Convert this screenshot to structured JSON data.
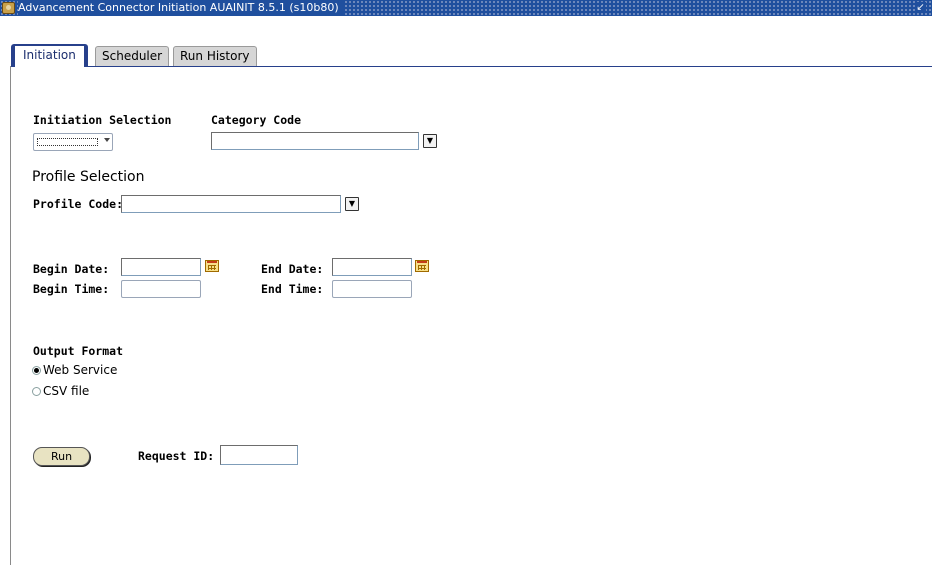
{
  "window": {
    "title": "Advancement Connector Initiation  AUAINIT  8.5.1  (s10b80)",
    "app_icon": "banner-app-icon",
    "maximize_icon": "maximize-icon"
  },
  "tabs": [
    {
      "label": "Initiation",
      "active": true
    },
    {
      "label": "Scheduler",
      "active": false
    },
    {
      "label": "Run History",
      "active": false
    }
  ],
  "form": {
    "initiation_selection": {
      "label": "Initiation Selection",
      "value": ""
    },
    "category_code": {
      "label": "Category Code",
      "value": ""
    },
    "profile_section_title": "Profile Selection",
    "profile_code": {
      "label": "Profile Code:",
      "value": ""
    },
    "begin_date": {
      "label": "Begin Date:",
      "value": ""
    },
    "end_date": {
      "label": "End Date:",
      "value": ""
    },
    "begin_time": {
      "label": "Begin Time:",
      "value": ""
    },
    "end_time": {
      "label": "End Time:",
      "value": ""
    },
    "output_format": {
      "label": "Output Format",
      "options": [
        {
          "label": "Web Service",
          "checked": true
        },
        {
          "label": "CSV file",
          "checked": false
        }
      ]
    },
    "run_button": "Run",
    "request_id": {
      "label": "Request ID:",
      "value": ""
    }
  },
  "colors": {
    "titlebar": "#1f4f9e",
    "tab_accent": "#27408b",
    "button_face": "#e8e3c2"
  }
}
